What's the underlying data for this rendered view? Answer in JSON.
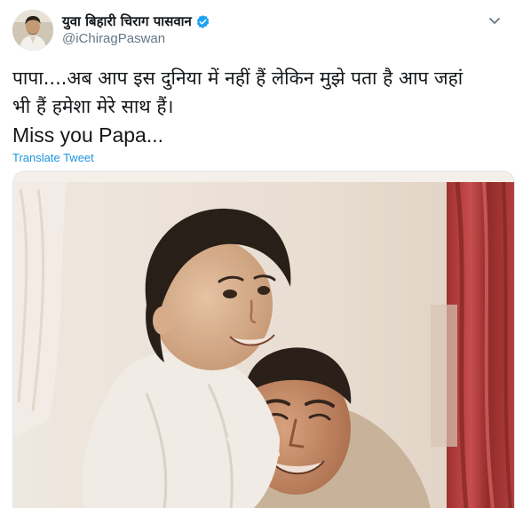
{
  "author": {
    "display_name": "युवा बिहारी चिराग पासवान",
    "handle": "@iChiragPaswan",
    "verified": true
  },
  "tweet": {
    "lines": [
      "पापा....अब आप इस दुनिया में नहीं हैं लेकिन मुझे पता है आप जहां",
      "भी हैं हमेशा मेरे साथ हैं।",
      "Miss you Papa..."
    ]
  },
  "actions": {
    "translate_label": "Translate Tweet"
  },
  "icons": {
    "verified": "verified-badge-icon",
    "more": "chevron-down-icon"
  },
  "colors": {
    "link": "#1b95e0",
    "verified": "#1da1f2",
    "text": "#14171a",
    "secondary": "#657786"
  }
}
